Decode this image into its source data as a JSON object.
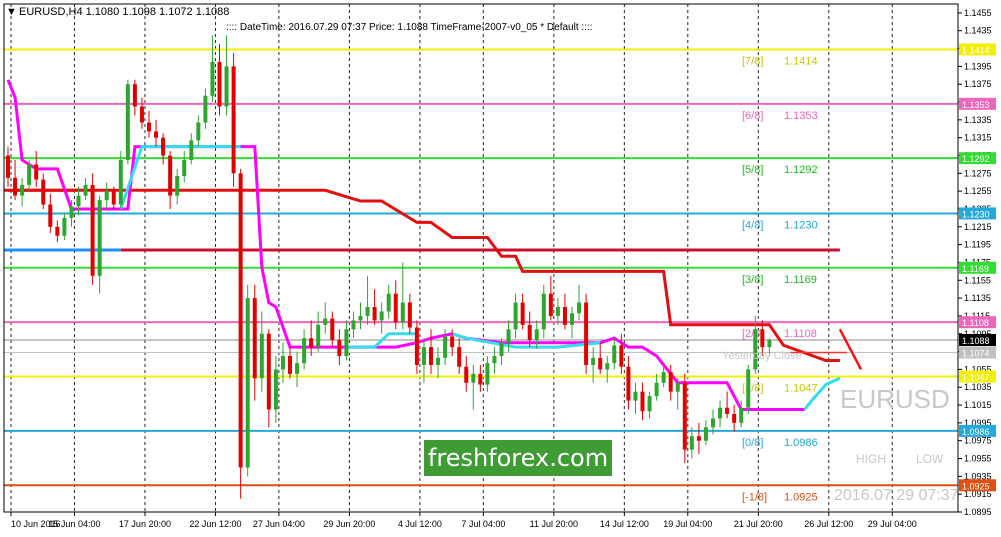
{
  "header": {
    "symbol_info": "EURUSD,H4  1.1080 1.1098 1.1072 1.1088",
    "info_line": ":::: DateTime: 2016.07.29 07:37   Price: 1.1088   TimeFrame-2007-v0_05   *  Default  ::::"
  },
  "watermark": {
    "brand": "freshforex.com",
    "symbol": "EURUSD",
    "high": "HIGH",
    "low": "LOW",
    "timestamp": "2016.07.29 07:37",
    "yesterday_close": "Yesterday Close"
  },
  "colors": {
    "bull": "#2ea52e",
    "bear": "#e00000",
    "magenta": "#ff00ff",
    "cyan": "#33ddee",
    "red_step": "#e01010",
    "crimson": "#c8102e",
    "blue_line": "#1e90ff"
  },
  "chart_data": {
    "type": "candlestick",
    "symbol": "EURUSD",
    "timeframe": "H4",
    "ylim": [
      1.0895,
      1.1465
    ],
    "y_ticks": [
      "1.1455",
      "1.1435",
      "1.1415",
      "1.1395",
      "1.1375",
      "1.1355",
      "1.1335",
      "1.1315",
      "1.1295",
      "1.1275",
      "1.1255",
      "1.1235",
      "1.1215",
      "1.1195",
      "1.1175",
      "1.1155",
      "1.1135",
      "1.1115",
      "1.1095",
      "1.1075",
      "1.1055",
      "1.1035",
      "1.1015",
      "1.0995",
      "1.0975",
      "1.0955",
      "1.0935",
      "1.0915",
      "1.0895"
    ],
    "x_ticks": [
      "10 Jun 2016",
      "15 Jun 04:00",
      "17 Jun 20:00",
      "22 Jun 12:00",
      "27 Jun 04:00",
      "29 Jun 20:00",
      "4 Jul 12:00",
      "7 Jul 04:00",
      "11 Jul 20:00",
      "14 Jul 12:00",
      "19 Jul 04:00",
      "21 Jul 20:00",
      "26 Jul 12:00",
      "29 Jul 04:00"
    ],
    "murrey_levels": [
      {
        "label": "[7/8]",
        "value": "1.1414",
        "price": 1.1414,
        "color": "#f0f000",
        "text_color": "#c8c800"
      },
      {
        "label": "[6/8]",
        "value": "1.1353",
        "price": 1.1353,
        "color": "#ee66bb",
        "text_color": "#ee66bb"
      },
      {
        "label": "[5/8]",
        "value": "1.1292",
        "price": 1.1292,
        "color": "#33dd33",
        "text_color": "#22bb22"
      },
      {
        "label": "[4/8]",
        "value": "1.1230",
        "price": 1.123,
        "color": "#22aadd",
        "text_color": "#22aadd"
      },
      {
        "label": "[3/8]",
        "value": "1.1169",
        "price": 1.1169,
        "color": "#33dd33",
        "text_color": "#22bb22"
      },
      {
        "label": "[2/8]",
        "value": "1.1108",
        "price": 1.1108,
        "color": "#ee66bb",
        "text_color": "#ee66bb"
      },
      {
        "label": "[1/8]",
        "value": "1.1047",
        "price": 1.1047,
        "color": "#f0f000",
        "text_color": "#c8c800"
      },
      {
        "label": "[0/8]",
        "value": "1.0986",
        "price": 1.0986,
        "color": "#22aadd",
        "text_color": "#22aadd"
      },
      {
        "label": "[-1/8]",
        "value": "1.0925",
        "price": 1.0925,
        "color": "#e05010",
        "text_color": "#e05010"
      }
    ],
    "price_tags": [
      {
        "text": "1.1414",
        "price": 1.1414,
        "bg": "#f0f000",
        "fg": "#ffffff"
      },
      {
        "text": "1.1353",
        "price": 1.1353,
        "bg": "#ee66bb",
        "fg": "#ffffff"
      },
      {
        "text": "1.1292",
        "price": 1.1292,
        "bg": "#33dd33",
        "fg": "#ffffff"
      },
      {
        "text": "1.1230",
        "price": 1.123,
        "bg": "#22aadd",
        "fg": "#ffffff"
      },
      {
        "text": "1.1169",
        "price": 1.1169,
        "bg": "#33dd33",
        "fg": "#ffffff"
      },
      {
        "text": "1.1108",
        "price": 1.1108,
        "bg": "#ee66bb",
        "fg": "#ffffff"
      },
      {
        "text": "1.1088",
        "price": 1.1088,
        "bg": "#000000",
        "fg": "#ffffff"
      },
      {
        "text": "1.1074",
        "price": 1.1074,
        "bg": "#c0c0c0",
        "fg": "#ffffff"
      },
      {
        "text": "1.1047",
        "price": 1.1047,
        "bg": "#f0f000",
        "fg": "#ffffff"
      },
      {
        "text": "1.0986",
        "price": 1.0986,
        "bg": "#22aadd",
        "fg": "#ffffff"
      },
      {
        "text": "1.0925",
        "price": 1.0925,
        "bg": "#e05010",
        "fg": "#ffffff"
      }
    ],
    "current_price": 1.1088,
    "yesterday_close": 1.1074,
    "extra_lines": [
      {
        "name": "blue-short-line",
        "price": 1.1189,
        "x_from": 0,
        "x_to": 16,
        "color": "#1e90ff"
      },
      {
        "name": "crimson-long-line",
        "price": 1.1189,
        "x_from": 16,
        "x_to": 118,
        "color": "#c8102e"
      },
      {
        "name": "red-short-line",
        "price": 1.1256,
        "x_from": 0,
        "x_to": 10,
        "color": "#e01010"
      }
    ],
    "red_step": [
      [
        0,
        1.1256
      ],
      [
        45,
        1.1256
      ],
      [
        50,
        1.1244
      ],
      [
        53,
        1.1244
      ],
      [
        58,
        1.122
      ],
      [
        60,
        1.122
      ],
      [
        63,
        1.1203
      ],
      [
        68,
        1.1203
      ],
      [
        70,
        1.1182
      ],
      [
        72,
        1.1182
      ],
      [
        73,
        1.1165
      ],
      [
        93,
        1.1165
      ],
      [
        94,
        1.1105
      ],
      [
        108,
        1.1105
      ],
      [
        110,
        1.1082
      ],
      [
        116,
        1.1065
      ],
      [
        118,
        1.1065
      ]
    ],
    "magenta_line": [
      [
        0,
        1.138
      ],
      [
        1,
        1.136
      ],
      [
        2,
        1.129
      ],
      [
        4,
        1.128
      ],
      [
        7,
        1.128
      ],
      [
        9,
        1.1235
      ],
      [
        16,
        1.1235
      ],
      [
        17,
        1.1235
      ],
      [
        18,
        1.1305
      ],
      [
        33,
        1.1305
      ],
      [
        34,
        1.1305
      ],
      [
        35,
        1.1305
      ],
      [
        36,
        1.117
      ],
      [
        37,
        1.113
      ],
      [
        38,
        1.1125
      ],
      [
        40,
        1.108
      ],
      [
        45,
        1.108
      ],
      [
        50,
        1.108
      ],
      [
        55,
        1.108
      ],
      [
        58,
        1.1085
      ],
      [
        60,
        1.109
      ],
      [
        63,
        1.1095
      ],
      [
        65,
        1.109
      ],
      [
        70,
        1.1085
      ],
      [
        72,
        1.1085
      ],
      [
        78,
        1.1085
      ],
      [
        84,
        1.1085
      ],
      [
        86,
        1.109
      ],
      [
        88,
        1.108
      ],
      [
        90,
        1.108
      ],
      [
        92,
        1.107
      ],
      [
        93,
        1.106
      ],
      [
        95,
        1.104
      ],
      [
        102,
        1.104
      ],
      [
        104,
        1.101
      ],
      [
        113,
        1.101
      ]
    ],
    "cyan_segments": [
      [
        [
          16,
          1.1235
        ],
        [
          19,
          1.1305
        ],
        [
          33,
          1.1305
        ]
      ],
      [
        [
          48,
          1.108
        ],
        [
          52,
          1.108
        ],
        [
          54,
          1.1095
        ],
        [
          58,
          1.1095
        ]
      ],
      [
        [
          63,
          1.1095
        ],
        [
          65,
          1.109
        ],
        [
          72,
          1.108
        ],
        [
          76,
          1.108
        ],
        [
          78,
          1.108
        ],
        [
          84,
          1.1085
        ]
      ],
      [
        [
          113,
          1.101
        ],
        [
          114,
          1.102
        ],
        [
          116,
          1.1038
        ],
        [
          118,
          1.1045
        ]
      ]
    ],
    "red_arrow": [
      [
        118,
        1.11
      ],
      [
        121,
        1.1055
      ]
    ],
    "yclose_segment": [
      [
        111,
        1.1074
      ],
      [
        119,
        1.1074
      ]
    ],
    "candles": [
      [
        1.1295,
        1.1305,
        1.126,
        1.127
      ],
      [
        1.127,
        1.129,
        1.1245,
        1.125
      ],
      [
        1.125,
        1.127,
        1.1238,
        1.1262
      ],
      [
        1.1262,
        1.129,
        1.1255,
        1.1285
      ],
      [
        1.1285,
        1.13,
        1.126,
        1.1268
      ],
      [
        1.1268,
        1.1275,
        1.1235,
        1.124
      ],
      [
        1.124,
        1.1252,
        1.1208,
        1.1215
      ],
      [
        1.1215,
        1.1222,
        1.1198,
        1.1205
      ],
      [
        1.1205,
        1.123,
        1.12,
        1.1225
      ],
      [
        1.1225,
        1.1245,
        1.1215,
        1.1238
      ],
      [
        1.1238,
        1.126,
        1.1228,
        1.125
      ],
      [
        1.125,
        1.127,
        1.1245,
        1.1262
      ],
      [
        1.1262,
        1.1275,
        1.115,
        1.116
      ],
      [
        1.116,
        1.125,
        1.114,
        1.1245
      ],
      [
        1.1245,
        1.1265,
        1.1235,
        1.1255
      ],
      [
        1.1255,
        1.126,
        1.1235,
        1.124
      ],
      [
        1.124,
        1.13,
        1.1235,
        1.129
      ],
      [
        1.129,
        1.138,
        1.1285,
        1.1375
      ],
      [
        1.1375,
        1.138,
        1.134,
        1.135
      ],
      [
        1.135,
        1.136,
        1.1325,
        1.1332
      ],
      [
        1.1332,
        1.1345,
        1.1315,
        1.1322
      ],
      [
        1.1322,
        1.1335,
        1.1305,
        1.1315
      ],
      [
        1.1315,
        1.132,
        1.1285,
        1.1295
      ],
      [
        1.1295,
        1.13,
        1.1235,
        1.125
      ],
      [
        1.125,
        1.128,
        1.124,
        1.1272
      ],
      [
        1.1272,
        1.13,
        1.1265,
        1.129
      ],
      [
        1.129,
        1.132,
        1.1285,
        1.1312
      ],
      [
        1.1312,
        1.134,
        1.1305,
        1.1332
      ],
      [
        1.1332,
        1.137,
        1.1325,
        1.1362
      ],
      [
        1.1362,
        1.143,
        1.1355,
        1.14
      ],
      [
        1.14,
        1.142,
        1.134,
        1.135
      ],
      [
        1.135,
        1.143,
        1.134,
        1.1395
      ],
      [
        1.1395,
        1.141,
        1.126,
        1.1275
      ],
      [
        1.1275,
        1.128,
        1.091,
        1.0945
      ],
      [
        1.0945,
        1.115,
        1.0935,
        1.1135
      ],
      [
        1.1135,
        1.115,
        1.102,
        1.1045
      ],
      [
        1.1045,
        1.112,
        1.103,
        1.1095
      ],
      [
        1.1095,
        1.11,
        1.099,
        1.101
      ],
      [
        1.101,
        1.107,
        1.0995,
        1.1055
      ],
      [
        1.1055,
        1.1085,
        1.104,
        1.107
      ],
      [
        1.107,
        1.108,
        1.1045,
        1.105
      ],
      [
        1.105,
        1.1075,
        1.1035,
        1.1062
      ],
      [
        1.1062,
        1.11,
        1.1055,
        1.109
      ],
      [
        1.109,
        1.111,
        1.107,
        1.108
      ],
      [
        1.108,
        1.112,
        1.1075,
        1.1105
      ],
      [
        1.1105,
        1.113,
        1.1095,
        1.1112
      ],
      [
        1.1112,
        1.112,
        1.108,
        1.1088
      ],
      [
        1.1088,
        1.11,
        1.106,
        1.107
      ],
      [
        1.107,
        1.111,
        1.1065,
        1.11
      ],
      [
        1.11,
        1.112,
        1.109,
        1.111
      ],
      [
        1.111,
        1.113,
        1.11,
        1.1115
      ],
      [
        1.1115,
        1.116,
        1.1105,
        1.1125
      ],
      [
        1.1125,
        1.1145,
        1.1105,
        1.111
      ],
      [
        1.111,
        1.113,
        1.1095,
        1.112
      ],
      [
        1.112,
        1.115,
        1.1112,
        1.114
      ],
      [
        1.114,
        1.1155,
        1.11,
        1.1108
      ],
      [
        1.1108,
        1.1175,
        1.11,
        1.113
      ],
      [
        1.113,
        1.114,
        1.1095,
        1.1102
      ],
      [
        1.1102,
        1.111,
        1.105,
        1.106
      ],
      [
        1.106,
        1.109,
        1.104,
        1.108
      ],
      [
        1.108,
        1.11,
        1.105,
        1.106
      ],
      [
        1.106,
        1.108,
        1.1045,
        1.1068
      ],
      [
        1.1068,
        1.11,
        1.106,
        1.1092
      ],
      [
        1.1092,
        1.11,
        1.107,
        1.108
      ],
      [
        1.108,
        1.109,
        1.105,
        1.1058
      ],
      [
        1.1058,
        1.107,
        1.103,
        1.104
      ],
      [
        1.104,
        1.106,
        1.101,
        1.105
      ],
      [
        1.105,
        1.106,
        1.103,
        1.1038
      ],
      [
        1.1038,
        1.107,
        1.103,
        1.1062
      ],
      [
        1.1062,
        1.108,
        1.105,
        1.107
      ],
      [
        1.107,
        1.109,
        1.106,
        1.1085
      ],
      [
        1.1085,
        1.111,
        1.1075,
        1.11
      ],
      [
        1.11,
        1.114,
        1.109,
        1.113
      ],
      [
        1.113,
        1.114,
        1.11,
        1.1105
      ],
      [
        1.1105,
        1.112,
        1.108,
        1.1088
      ],
      [
        1.1088,
        1.111,
        1.1078,
        1.11
      ],
      [
        1.11,
        1.115,
        1.109,
        1.114
      ],
      [
        1.114,
        1.116,
        1.111,
        1.1115
      ],
      [
        1.1115,
        1.1135,
        1.1105,
        1.1125
      ],
      [
        1.1125,
        1.114,
        1.11,
        1.1105
      ],
      [
        1.1105,
        1.1125,
        1.109,
        1.1118
      ],
      [
        1.1118,
        1.115,
        1.111,
        1.113
      ],
      [
        1.113,
        1.114,
        1.105,
        1.106
      ],
      [
        1.106,
        1.108,
        1.104,
        1.1068
      ],
      [
        1.1068,
        1.1085,
        1.105,
        1.1055
      ],
      [
        1.1055,
        1.107,
        1.104,
        1.1062
      ],
      [
        1.1062,
        1.109,
        1.1055,
        1.1082
      ],
      [
        1.1082,
        1.1095,
        1.105,
        1.1058
      ],
      [
        1.1058,
        1.107,
        1.101,
        1.102
      ],
      [
        1.102,
        1.104,
        1.1005,
        1.103
      ],
      [
        1.103,
        1.104,
        1.0998,
        1.1008
      ],
      [
        1.1008,
        1.103,
        1.1,
        1.1025
      ],
      [
        1.1025,
        1.105,
        1.102,
        1.104
      ],
      [
        1.104,
        1.106,
        1.1035,
        1.1052
      ],
      [
        1.1052,
        1.106,
        1.102,
        1.103
      ],
      [
        1.103,
        1.1045,
        1.101,
        1.104
      ],
      [
        1.104,
        1.105,
        1.095,
        1.0965
      ],
      [
        1.0965,
        1.099,
        1.0955,
        1.098
      ],
      [
        1.098,
        1.0995,
        1.096,
        1.0975
      ],
      [
        1.0975,
        1.0998,
        1.097,
        1.099
      ],
      [
        1.099,
        1.101,
        1.0982,
        1.1
      ],
      [
        1.1,
        1.102,
        1.099,
        1.1012
      ],
      [
        1.1012,
        1.103,
        1.1,
        1.1005
      ],
      [
        1.1005,
        1.1015,
        1.0985,
        1.0995
      ],
      [
        1.0995,
        1.102,
        1.099,
        1.1012
      ],
      [
        1.1012,
        1.106,
        1.1005,
        1.1055
      ],
      [
        1.1055,
        1.1115,
        1.105,
        1.11
      ],
      [
        1.11,
        1.111,
        1.107,
        1.108
      ],
      [
        1.108,
        1.109,
        1.107,
        1.1088
      ]
    ]
  }
}
